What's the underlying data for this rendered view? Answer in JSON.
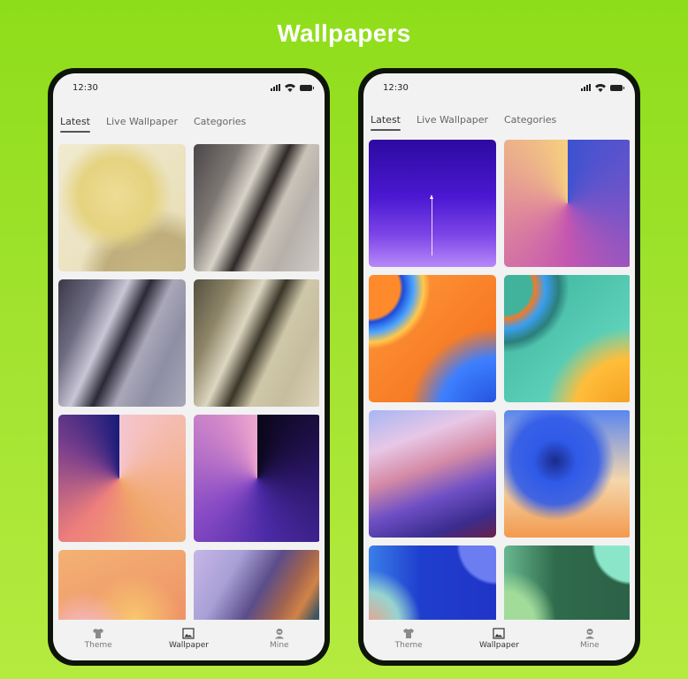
{
  "page": {
    "title": "Wallpapers"
  },
  "colors": {
    "background_top": "#8edd1a",
    "background_bottom": "#b5eb3f",
    "screen": "#f2f2f2",
    "frame": "#0e140a"
  },
  "phones": [
    {
      "status": {
        "time": "12:30",
        "icons": [
          "signal-icon",
          "wifi-icon",
          "battery-icon"
        ]
      },
      "tabs": [
        {
          "label": "Latest",
          "active": true
        },
        {
          "label": "Live Wallpaper",
          "active": false
        },
        {
          "label": "Categories",
          "active": false
        }
      ],
      "wallpapers": [
        "gold spheres",
        "silver crystal",
        "violet crystal",
        "beige crystal",
        "peach conic gradient",
        "purple conic gradient",
        "pastel clouds",
        "layered waves"
      ],
      "bottom_nav": [
        {
          "label": "Theme",
          "icon": "shirt-icon",
          "active": false
        },
        {
          "label": "Wallpaper",
          "icon": "image-icon",
          "active": true
        },
        {
          "label": "Mine",
          "icon": "user-icon",
          "active": false
        }
      ]
    },
    {
      "status": {
        "time": "12:30",
        "icons": [
          "signal-icon",
          "wifi-icon",
          "battery-icon"
        ]
      },
      "tabs": [
        {
          "label": "Latest",
          "active": true
        },
        {
          "label": "Live Wallpaper",
          "active": false
        },
        {
          "label": "Categories",
          "active": false
        }
      ],
      "wallpapers": [
        "violet gradient with arrow",
        "blue-peach conic gradient",
        "orange blue swirl",
        "teal orange swirl",
        "brush strokes",
        "blue flower",
        "blue curve",
        "green curve"
      ],
      "bottom_nav": [
        {
          "label": "Theme",
          "icon": "shirt-icon",
          "active": false
        },
        {
          "label": "Wallpaper",
          "icon": "image-icon",
          "active": true
        },
        {
          "label": "Mine",
          "icon": "user-icon",
          "active": false
        }
      ]
    }
  ]
}
